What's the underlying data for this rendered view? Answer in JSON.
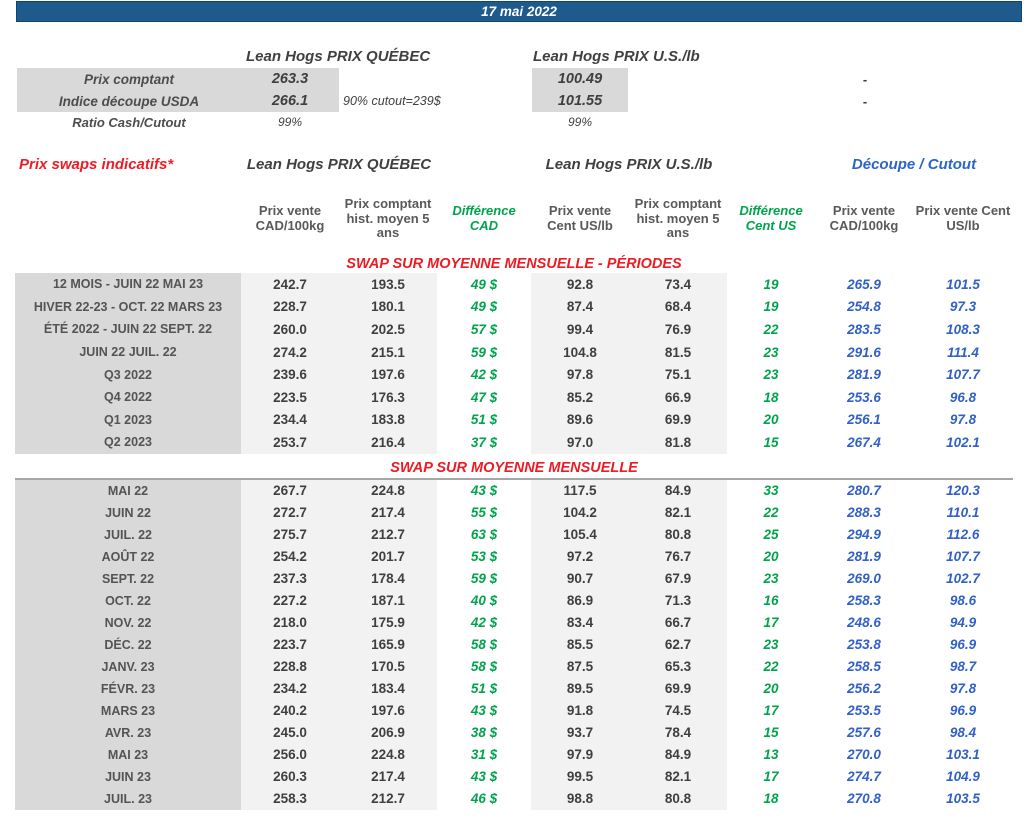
{
  "title_bar": {
    "date": "17 mai 2022"
  },
  "summary": {
    "quebec": {
      "header": "Lean Hogs PRIX QUÉBEC",
      "rows": [
        {
          "label": "Prix comptant",
          "value": "263.3"
        },
        {
          "label": "Indice découpe USDA",
          "value": "266.1"
        },
        {
          "label": "Ratio Cash/Cutout",
          "value": "99%"
        }
      ],
      "note": "90% cutout=239$"
    },
    "us": {
      "header": "Lean Hogs PRIX U.S./lb",
      "rows": [
        {
          "value": "100.49",
          "dash": "-"
        },
        {
          "value": "101.55",
          "dash": "-"
        },
        {
          "value": "99%"
        }
      ]
    }
  },
  "swaps": {
    "title": "Prix swaps indicatifs*",
    "quebec_header": "Lean Hogs PRIX QUÉBEC",
    "us_header": "Lean Hogs PRIX U.S./lb",
    "cutout_header": "Découpe / Cutout",
    "column_headers": [
      "Prix vente CAD/100kg",
      "Prix comptant hist. moyen 5 ans",
      "Différence CAD",
      "Prix vente Cent US/lb",
      "Prix comptant hist. moyen 5 ans",
      "Différence Cent US",
      "Prix vente CAD/100kg",
      "Prix vente Cent US/lb"
    ]
  },
  "sections": [
    {
      "title": "SWAP SUR MOYENNE MENSUELLE - PÉRIODES",
      "rows": [
        {
          "label": "12 MOIS - JUIN 22 MAI 23",
          "values": [
            "242.7",
            "193.5",
            "49 $",
            "92.8",
            "73.4",
            "19",
            "265.9",
            "101.5"
          ]
        },
        {
          "label": "HIVER 22-23 - OCT. 22 MARS 23",
          "values": [
            "228.7",
            "180.1",
            "49 $",
            "87.4",
            "68.4",
            "19",
            "254.8",
            "97.3"
          ]
        },
        {
          "label": "ÉTÉ 2022 - JUIN 22 SEPT. 22",
          "values": [
            "260.0",
            "202.5",
            "57 $",
            "99.4",
            "76.9",
            "22",
            "283.5",
            "108.3"
          ]
        },
        {
          "label": "JUIN 22 JUIL. 22",
          "values": [
            "274.2",
            "215.1",
            "59 $",
            "104.8",
            "81.5",
            "23",
            "291.6",
            "111.4"
          ]
        },
        {
          "label": "Q3 2022",
          "values": [
            "239.6",
            "197.6",
            "42 $",
            "97.8",
            "75.1",
            "23",
            "281.9",
            "107.7"
          ]
        },
        {
          "label": "Q4 2022",
          "values": [
            "223.5",
            "176.3",
            "47 $",
            "85.2",
            "66.9",
            "18",
            "253.6",
            "96.8"
          ]
        },
        {
          "label": "Q1 2023",
          "values": [
            "234.4",
            "183.8",
            "51 $",
            "89.6",
            "69.9",
            "20",
            "256.1",
            "97.8"
          ]
        },
        {
          "label": "Q2 2023",
          "values": [
            "253.7",
            "216.4",
            "37 $",
            "97.0",
            "81.8",
            "15",
            "267.4",
            "102.1"
          ]
        }
      ]
    },
    {
      "title": "SWAP SUR MOYENNE MENSUELLE",
      "rows": [
        {
          "label": "MAI 22",
          "values": [
            "267.7",
            "224.8",
            "43 $",
            "117.5",
            "84.9",
            "33",
            "280.7",
            "120.3"
          ]
        },
        {
          "label": "JUIN 22",
          "values": [
            "272.7",
            "217.4",
            "55 $",
            "104.2",
            "82.1",
            "22",
            "288.3",
            "110.1"
          ]
        },
        {
          "label": "JUIL. 22",
          "values": [
            "275.7",
            "212.7",
            "63 $",
            "105.4",
            "80.8",
            "25",
            "294.9",
            "112.6"
          ]
        },
        {
          "label": "AOÛT 22",
          "values": [
            "254.2",
            "201.7",
            "53 $",
            "97.2",
            "76.7",
            "20",
            "281.9",
            "107.7"
          ]
        },
        {
          "label": "SEPT. 22",
          "values": [
            "237.3",
            "178.4",
            "59 $",
            "90.7",
            "67.9",
            "23",
            "269.0",
            "102.7"
          ]
        },
        {
          "label": "OCT. 22",
          "values": [
            "227.2",
            "187.1",
            "40 $",
            "86.9",
            "71.3",
            "16",
            "258.3",
            "98.6"
          ]
        },
        {
          "label": "NOV. 22",
          "values": [
            "218.0",
            "175.9",
            "42 $",
            "83.4",
            "66.7",
            "17",
            "248.6",
            "94.9"
          ]
        },
        {
          "label": "DÉC. 22",
          "values": [
            "223.7",
            "165.9",
            "58 $",
            "85.5",
            "62.7",
            "23",
            "253.8",
            "96.9"
          ]
        },
        {
          "label": "JANV. 23",
          "values": [
            "228.8",
            "170.5",
            "58 $",
            "87.5",
            "65.3",
            "22",
            "258.5",
            "98.7"
          ]
        },
        {
          "label": "FÉVR. 23",
          "values": [
            "234.2",
            "183.4",
            "51 $",
            "89.5",
            "69.9",
            "20",
            "256.2",
            "97.8"
          ]
        },
        {
          "label": "MARS 23",
          "values": [
            "240.2",
            "197.6",
            "43 $",
            "91.8",
            "74.5",
            "17",
            "253.5",
            "96.9"
          ]
        },
        {
          "label": "AVR. 23",
          "values": [
            "245.0",
            "206.9",
            "38 $",
            "93.7",
            "78.4",
            "15",
            "257.6",
            "98.4"
          ]
        },
        {
          "label": "MAI 23",
          "values": [
            "256.0",
            "224.8",
            "31 $",
            "97.9",
            "84.9",
            "13",
            "270.0",
            "103.1"
          ]
        },
        {
          "label": "JUIN 23",
          "values": [
            "260.3",
            "217.4",
            "43 $",
            "99.5",
            "82.1",
            "17",
            "274.7",
            "104.9"
          ]
        },
        {
          "label": "JUIL. 23",
          "values": [
            "258.3",
            "212.7",
            "46 $",
            "98.8",
            "80.8",
            "18",
            "270.8",
            "103.5"
          ]
        }
      ]
    }
  ],
  "colors": {
    "banner_blue": "#1E5A8C",
    "title_red": "#ED1C24",
    "difference_green": "#00A44C",
    "cutout_blue": "#3060C8",
    "label_bg": "#D9D9D9",
    "stripe_bg": "#F2F2F2"
  }
}
